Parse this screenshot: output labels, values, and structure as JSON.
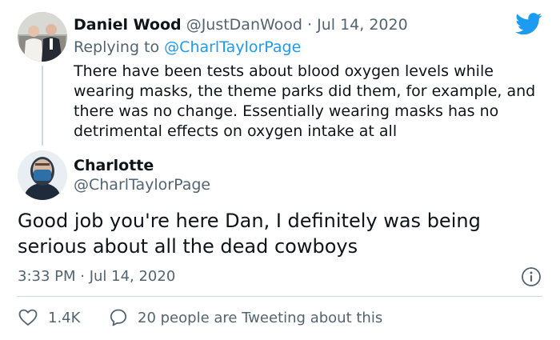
{
  "reply": {
    "author_name": "Daniel Wood",
    "author_handle": "@JustDanWood",
    "separator": "·",
    "date": "Jul 14, 2020",
    "replying_to_label": "Replying to",
    "replying_to_handle": "@CharlTaylorPage",
    "text": "There have been tests about blood oxygen levels while wearing masks, the theme parks did them, for example, and there was no change. Essentially wearing masks has no detrimental effects on oxygen intake at all"
  },
  "tweet": {
    "author_name": "Charlotte",
    "author_handle": "@CharlTaylorPage",
    "text": "Good job you're here Dan, I definitely was being serious about all the dead cowboys",
    "timestamp": "3:33 PM · Jul 14, 2020"
  },
  "actions": {
    "like_count": "1.4K",
    "conversation_label": "20 people are Tweeting about this"
  },
  "icons": {
    "brand": "twitter-bird-icon",
    "info": "info-icon",
    "like": "heart-icon",
    "conversation": "speech-bubble-icon"
  },
  "colors": {
    "brand_blue": "#1d9bf0",
    "text_primary": "#0f1419",
    "text_muted": "#536471",
    "divider": "#cfd9de"
  }
}
